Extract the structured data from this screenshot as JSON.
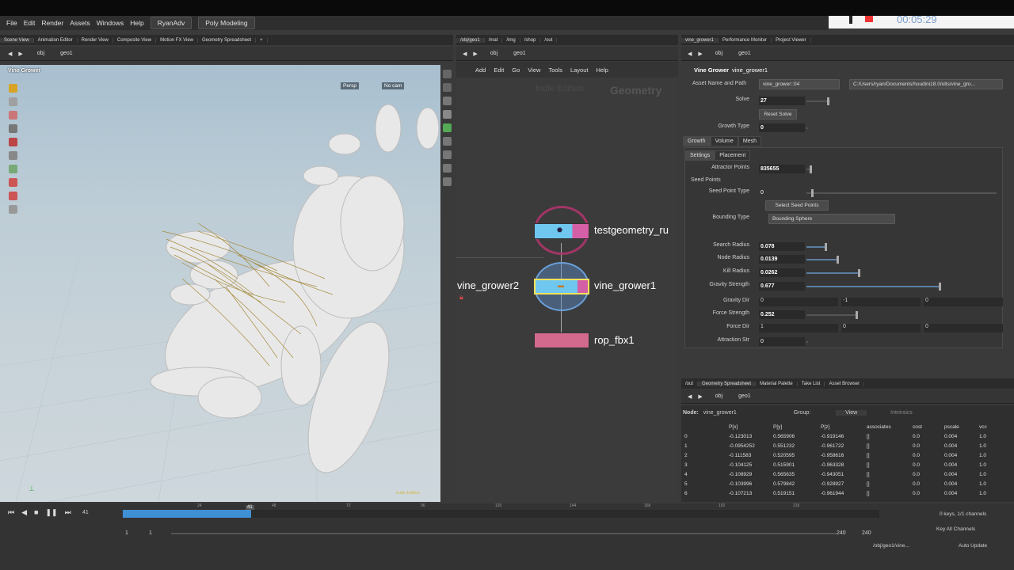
{
  "menu": {
    "items": [
      "File",
      "Edit",
      "Render",
      "Assets",
      "Windows",
      "Help"
    ],
    "desktop": "RyanAdv",
    "mode": "Poly Modeling"
  },
  "left_tabs": [
    "Scene View",
    "Animation Editor",
    "Render View",
    "Composite View",
    "Motion FX View",
    "Geometry Spreadsheet"
  ],
  "left_path": {
    "root": "obj",
    "node": "geo1"
  },
  "viewport": {
    "title": "Vine Grower",
    "camera": "Persp",
    "cam2": "No cam",
    "watermark": "Indie Edition"
  },
  "net_tabs": [
    "/obj/geo1",
    "/mat",
    "/img",
    "/shop",
    "/out"
  ],
  "net_path": {
    "root": "obj",
    "node": "geo1"
  },
  "net_menu": [
    "Add",
    "Edit",
    "Go",
    "View",
    "Tools",
    "Layout",
    "Help"
  ],
  "net_watermark": {
    "edition": "Indie Edition",
    "context": "Geometry"
  },
  "nodes": {
    "n1": "testgeometry_ru",
    "n2": "vine_grower2",
    "n3": "vine_grower1",
    "n4": "rop_fbx1"
  },
  "param_tabs": [
    "vine_grower1",
    "Performance Monitor",
    "Project Viewer"
  ],
  "param_path": {
    "root": "obj",
    "node": "geo1"
  },
  "params": {
    "type": "Vine Grower",
    "name": "vine_grower1",
    "asset_label": "Asset Name and Path",
    "asset_name": "vine_grower::04",
    "asset_path": "C:/Users/ryan/Documents/houdini18.0/otls/vine_gro...",
    "solve_label": "Solve",
    "solve": "27",
    "reset": "Reset Solve",
    "growth_type_label": "Growth Type",
    "growth_type": "0",
    "tabs": [
      "Growth",
      "Volume",
      "Mesh"
    ],
    "subtabs": [
      "Settings",
      "Placement"
    ],
    "attractor_label": "Attractor Points",
    "attractor": "835655",
    "seed_header": "Seed Points",
    "seed_type_label": "Seed Point Type",
    "seed_type": "0",
    "select_seed": "Select Seed Points",
    "bbox_label": "Bounding Type",
    "bbox": "Bounding Sphere",
    "rows": [
      {
        "label": "Search Radius",
        "value": "0.078",
        "k": 0.1
      },
      {
        "label": "Node Radius",
        "value": "0.0139",
        "k": 0.16
      },
      {
        "label": "Kill Radius",
        "value": "0.0262",
        "k": 0.27
      },
      {
        "label": "Gravity Strength",
        "value": "0.677",
        "k": 0.68
      }
    ],
    "gravity_dir_label": "Gravity Dir",
    "gravity_dir": [
      "0",
      "-1",
      "0"
    ],
    "force_strength_label": "Force Strength",
    "force_strength": "0.252",
    "force_dir_label": "Force Dir",
    "force_dir": [
      "1",
      "0",
      "0"
    ],
    "attraction_label": "Attraction Str",
    "attraction": "0"
  },
  "bottom_tabs": [
    "/out",
    "Geometry Spreadsheet",
    "Material Palette",
    "Take List",
    "Asset Browser"
  ],
  "bottom_path": {
    "root": "obj",
    "node": "geo1"
  },
  "sheet": {
    "node_label": "Node:",
    "node": "vine_grower1",
    "group_label": "Group:",
    "view": "View",
    "intrinsics": "Intrinsics",
    "headers": [
      "",
      "P[x]",
      "P[y]",
      "P[z]",
      "associates",
      "cost",
      "pscale",
      "vcc"
    ],
    "rows": [
      [
        "0",
        "-0.123013",
        "0.565906",
        "-0.919146",
        "[]",
        "0.0",
        "0.004",
        "1.0"
      ],
      [
        "1",
        "-0.0954252",
        "0.551232",
        "-0.961722",
        "[]",
        "0.0",
        "0.004",
        "1.0"
      ],
      [
        "2",
        "-0.111583",
        "0.520595",
        "-0.958616",
        "[]",
        "0.0",
        "0.004",
        "1.0"
      ],
      [
        "3",
        "-0.104125",
        "0.515901",
        "-0.963328",
        "[]",
        "0.0",
        "0.004",
        "1.0"
      ],
      [
        "4",
        "-0.108929",
        "0.565635",
        "-0.943051",
        "[]",
        "0.0",
        "0.004",
        "1.0"
      ],
      [
        "5",
        "-0.103996",
        "0.579842",
        "-0.928927",
        "[]",
        "0.0",
        "0.004",
        "1.0"
      ],
      [
        "6",
        "-0.107213",
        "0.519151",
        "-0.961944",
        "[]",
        "0.0",
        "0.004",
        "1.0"
      ]
    ]
  },
  "timeline": {
    "frame": "41",
    "ticks": [
      "24",
      "48",
      "72",
      "96",
      "120",
      "144",
      "168",
      "192",
      "216"
    ],
    "start": "1",
    "start2": "1",
    "end": "240",
    "end2": "240",
    "progress": 0.17,
    "keys": "0 keys, 1/1 channels",
    "key_all": "Key All Channels",
    "status_path": "/obj/geo1/vine...",
    "auto_update": "Auto Update"
  },
  "clock": "00:05:29"
}
